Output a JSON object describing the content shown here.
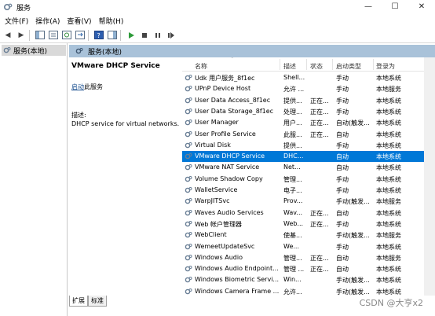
{
  "window": {
    "title": "服务"
  },
  "menu": [
    "文件(F)",
    "操作(A)",
    "查看(V)",
    "帮助(H)"
  ],
  "tree": {
    "root_label": "服务(本地)"
  },
  "panel": {
    "header": "服务(本地)"
  },
  "detail": {
    "service_name": "VMware DHCP Service",
    "start_link": "启动",
    "start_suffix": "此服务",
    "desc_label": "描述:",
    "desc_text": "DHCP service for virtual networks."
  },
  "list": {
    "columns": {
      "name": "名称",
      "desc": "描述",
      "status": "状态",
      "startup": "启动类型",
      "logon": "登录为"
    },
    "rows": [
      {
        "name": "Udk 用户服务_8f1ec",
        "desc": "Shell...",
        "status": "",
        "startup": "手动",
        "logon": "本地系统"
      },
      {
        "name": "UPnP Device Host",
        "desc": "允许 ...",
        "status": "",
        "startup": "手动",
        "logon": "本地服务"
      },
      {
        "name": "User Data Access_8f1ec",
        "desc": "提供...",
        "status": "正在...",
        "startup": "手动",
        "logon": "本地系统"
      },
      {
        "name": "User Data Storage_8f1ec",
        "desc": "处理...",
        "status": "正在...",
        "startup": "手动",
        "logon": "本地系统"
      },
      {
        "name": "User Manager",
        "desc": "用户...",
        "status": "正在...",
        "startup": "自动(触发...",
        "logon": "本地系统"
      },
      {
        "name": "User Profile Service",
        "desc": "此服...",
        "status": "正在...",
        "startup": "自动",
        "logon": "本地系统"
      },
      {
        "name": "Virtual Disk",
        "desc": "提供...",
        "status": "",
        "startup": "手动",
        "logon": "本地系统"
      },
      {
        "name": "VMware DHCP Service",
        "desc": "DHC...",
        "status": "",
        "startup": "自动",
        "logon": "本地系统",
        "selected": true
      },
      {
        "name": "VMware NAT Service",
        "desc": "Net...",
        "status": "",
        "startup": "自动",
        "logon": "本地系统"
      },
      {
        "name": "Volume Shadow Copy",
        "desc": "管理...",
        "status": "",
        "startup": "手动",
        "logon": "本地系统"
      },
      {
        "name": "WalletService",
        "desc": "电子...",
        "status": "",
        "startup": "手动",
        "logon": "本地系统"
      },
      {
        "name": "WarpJITSvc",
        "desc": "Prov...",
        "status": "",
        "startup": "手动(触发...",
        "logon": "本地服务"
      },
      {
        "name": "Waves Audio Services",
        "desc": "Wav...",
        "status": "正在...",
        "startup": "自动",
        "logon": "本地系统"
      },
      {
        "name": "Web 帐户管理器",
        "desc": "Web...",
        "status": "正在...",
        "startup": "手动",
        "logon": "本地系统"
      },
      {
        "name": "WebClient",
        "desc": "使基...",
        "status": "",
        "startup": "手动(触发...",
        "logon": "本地服务"
      },
      {
        "name": "WemeetUpdateSvc",
        "desc": "We...",
        "status": "",
        "startup": "手动",
        "logon": "本地系统"
      },
      {
        "name": "Windows Audio",
        "desc": "管理...",
        "status": "正在...",
        "startup": "自动",
        "logon": "本地服务"
      },
      {
        "name": "Windows Audio Endpoint...",
        "desc": "管理 ...",
        "status": "正在...",
        "startup": "自动",
        "logon": "本地系统"
      },
      {
        "name": "Windows Biometric Servi...",
        "desc": "Win...",
        "status": "",
        "startup": "手动(触发...",
        "logon": "本地系统"
      },
      {
        "name": "Windows Camera Frame ...",
        "desc": "允许...",
        "status": "",
        "startup": "手动(触发...",
        "logon": "本地系统"
      }
    ]
  },
  "tabs": [
    "扩展",
    "标准"
  ],
  "watermark": "CSDN @大亨x2",
  "colors": {
    "selection": "#0078d7",
    "header_bg": "#a9c2d9",
    "link": "#1a4f8f"
  }
}
